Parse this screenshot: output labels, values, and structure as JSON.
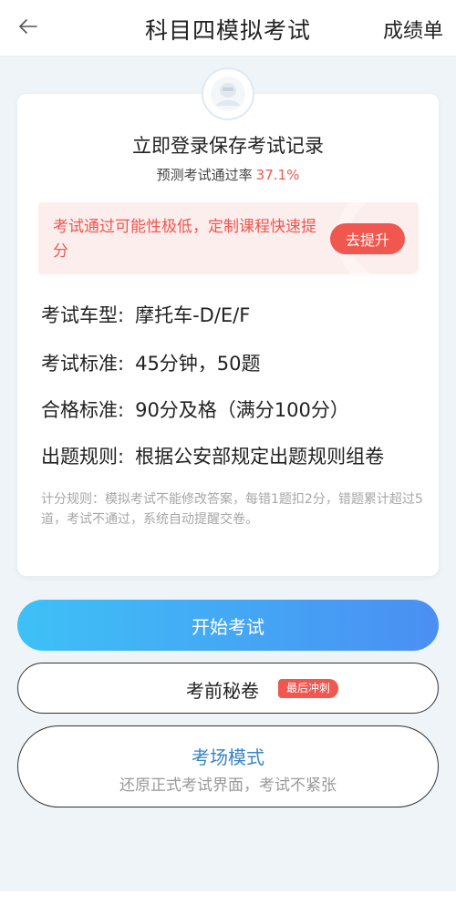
{
  "header": {
    "title": "科目四模拟考试",
    "right_link": "成绩单",
    "back_icon": "arrow-left-icon"
  },
  "login": {
    "avatar_icon": "user-avatar-icon",
    "title": "立即登录保存考试记录",
    "rate_label": "预测考试通过率",
    "rate_value": "37.1%"
  },
  "tip": {
    "text": "考试通过可能性极低，定制课程快速提分",
    "button": "去提升"
  },
  "info": [
    {
      "label": "考试车型:",
      "value": "摩托车-D/E/F"
    },
    {
      "label": "考试标准:",
      "value": "45分钟，50题"
    },
    {
      "label": "合格标准:",
      "value": "90分及格（满分100分）"
    },
    {
      "label": "出题规则:",
      "value": "根据公安部规定出题规则组卷"
    }
  ],
  "rule_note": "计分规则：模拟考试不能修改答案，每错1题扣2分，错题累计超过5道，考试不通过，系统自动提醒交卷。",
  "start_button": "开始考试",
  "secret": {
    "label": "考前秘卷",
    "badge": "最后冲刺"
  },
  "exam_mode": {
    "title": "考场模式",
    "subtitle": "还原正式考试界面，考试不紧张"
  },
  "colors": {
    "accent_red": "#f0574e",
    "start_gradient_left": "#3ec1f6",
    "start_gradient_right": "#4a8ff3",
    "mode_blue": "#3a84c4"
  }
}
